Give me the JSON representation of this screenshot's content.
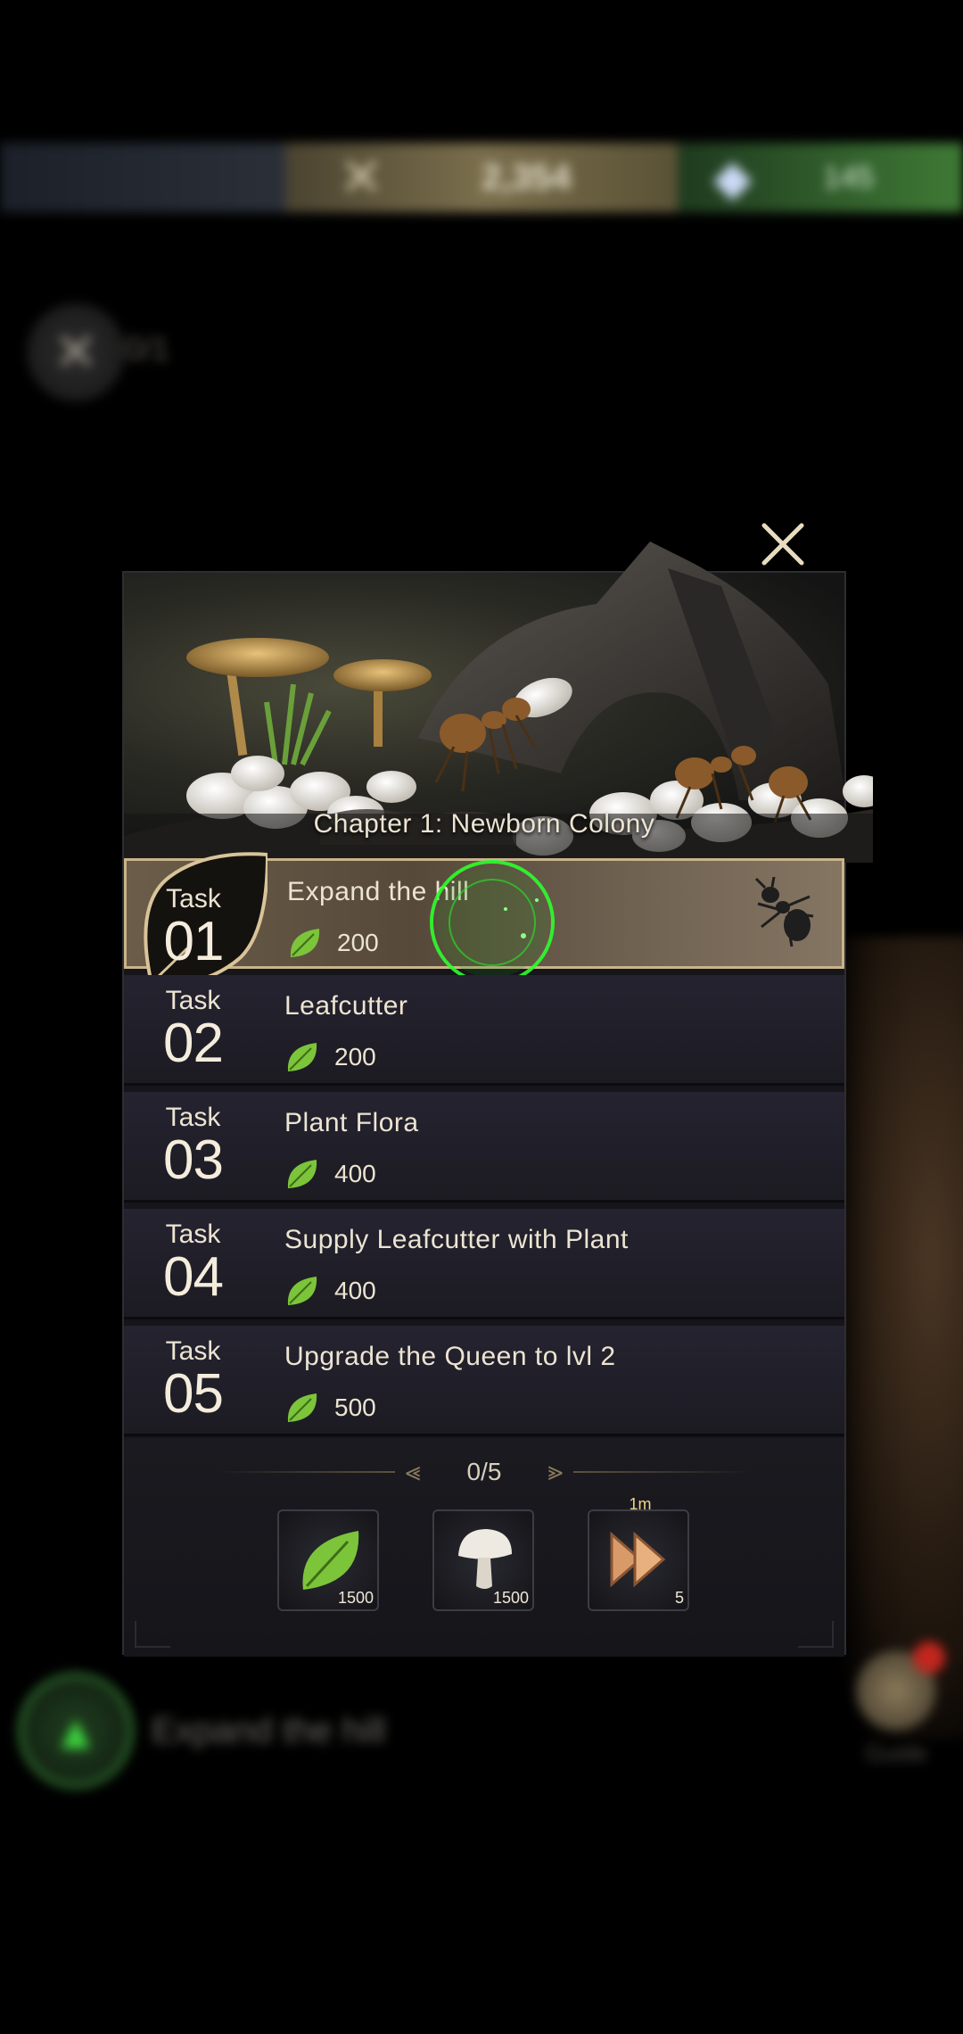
{
  "background": {
    "resource_value_1": "2,354",
    "resource_value_2": "145",
    "level_text": "0/1",
    "bottom_task_label": "Expand the hill",
    "bottom_right_label": "Guide"
  },
  "dialog": {
    "chapter_title": "Chapter 1: Newborn Colony",
    "task_word": "Task",
    "tasks": [
      {
        "number": "01",
        "title": "Expand the hill",
        "reward": "200",
        "active": true
      },
      {
        "number": "02",
        "title": "Leafcutter",
        "reward": "200",
        "active": false
      },
      {
        "number": "03",
        "title": "Plant Flora",
        "reward": "400",
        "active": false
      },
      {
        "number": "04",
        "title": "Supply Leafcutter with Plant",
        "reward": "400",
        "active": false
      },
      {
        "number": "05",
        "title": "Upgrade the Queen to lvl 2",
        "reward": "500",
        "active": false
      }
    ],
    "progress": "0/5",
    "chapter_rewards": [
      {
        "icon": "leaf-icon",
        "count": "1500"
      },
      {
        "icon": "mushroom-icon",
        "count": "1500"
      },
      {
        "icon": "speedup-icon",
        "count": "5",
        "duration": "1m"
      }
    ]
  },
  "colors": {
    "accent_gold": "#c9b48a",
    "leaf_green": "#7cc43a",
    "glow_green": "#2bff2b"
  }
}
